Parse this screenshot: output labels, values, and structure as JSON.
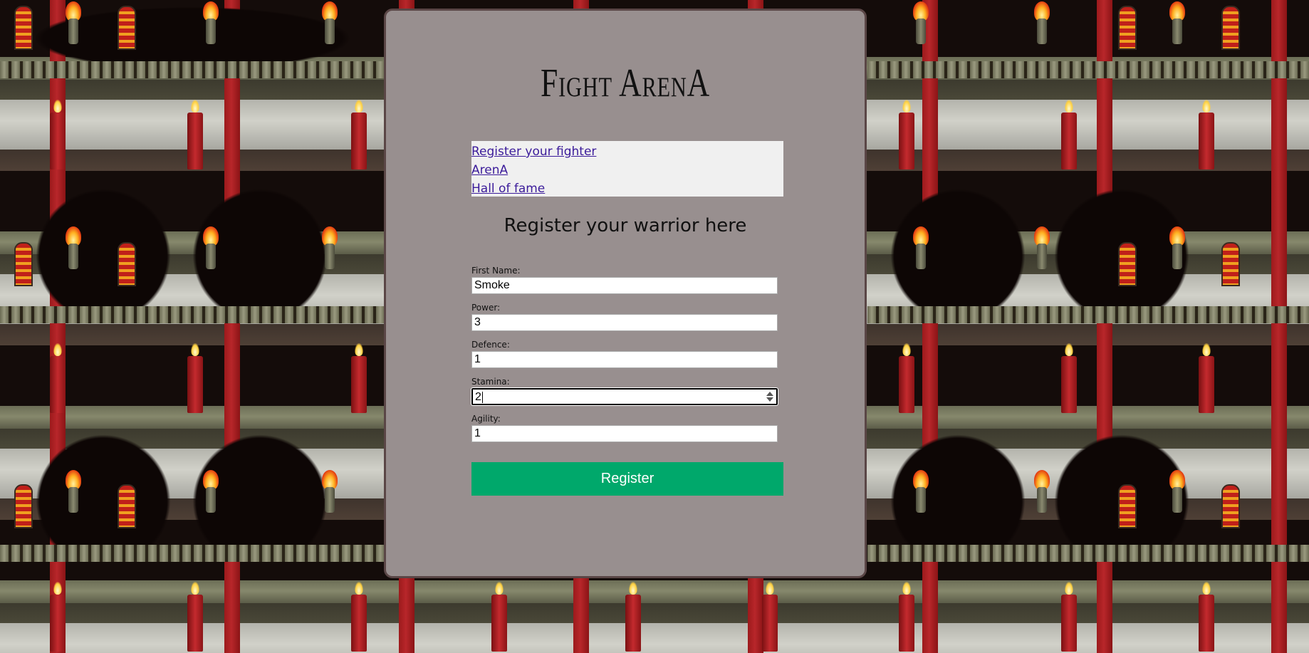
{
  "page": {
    "title": "Fight ArenA",
    "subtitle": "Register your warrior here"
  },
  "nav": {
    "items": [
      {
        "label": "Register your fighter"
      },
      {
        "label": "ArenA"
      },
      {
        "label": "Hall of fame"
      }
    ]
  },
  "form": {
    "fields": [
      {
        "label": "First Name:",
        "value": "Smoke"
      },
      {
        "label": "Power:",
        "value": "3"
      },
      {
        "label": "Defence:",
        "value": "1"
      },
      {
        "label": "Stamina:",
        "value": "2"
      },
      {
        "label": "Agility:",
        "value": "1"
      }
    ],
    "submit_label": "Register"
  },
  "colors": {
    "card_background": "#988f8f",
    "card_border": "#5a4646",
    "nav_background": "#f0f0f0",
    "link": "#3b1b9a",
    "button": "#00a86b"
  }
}
